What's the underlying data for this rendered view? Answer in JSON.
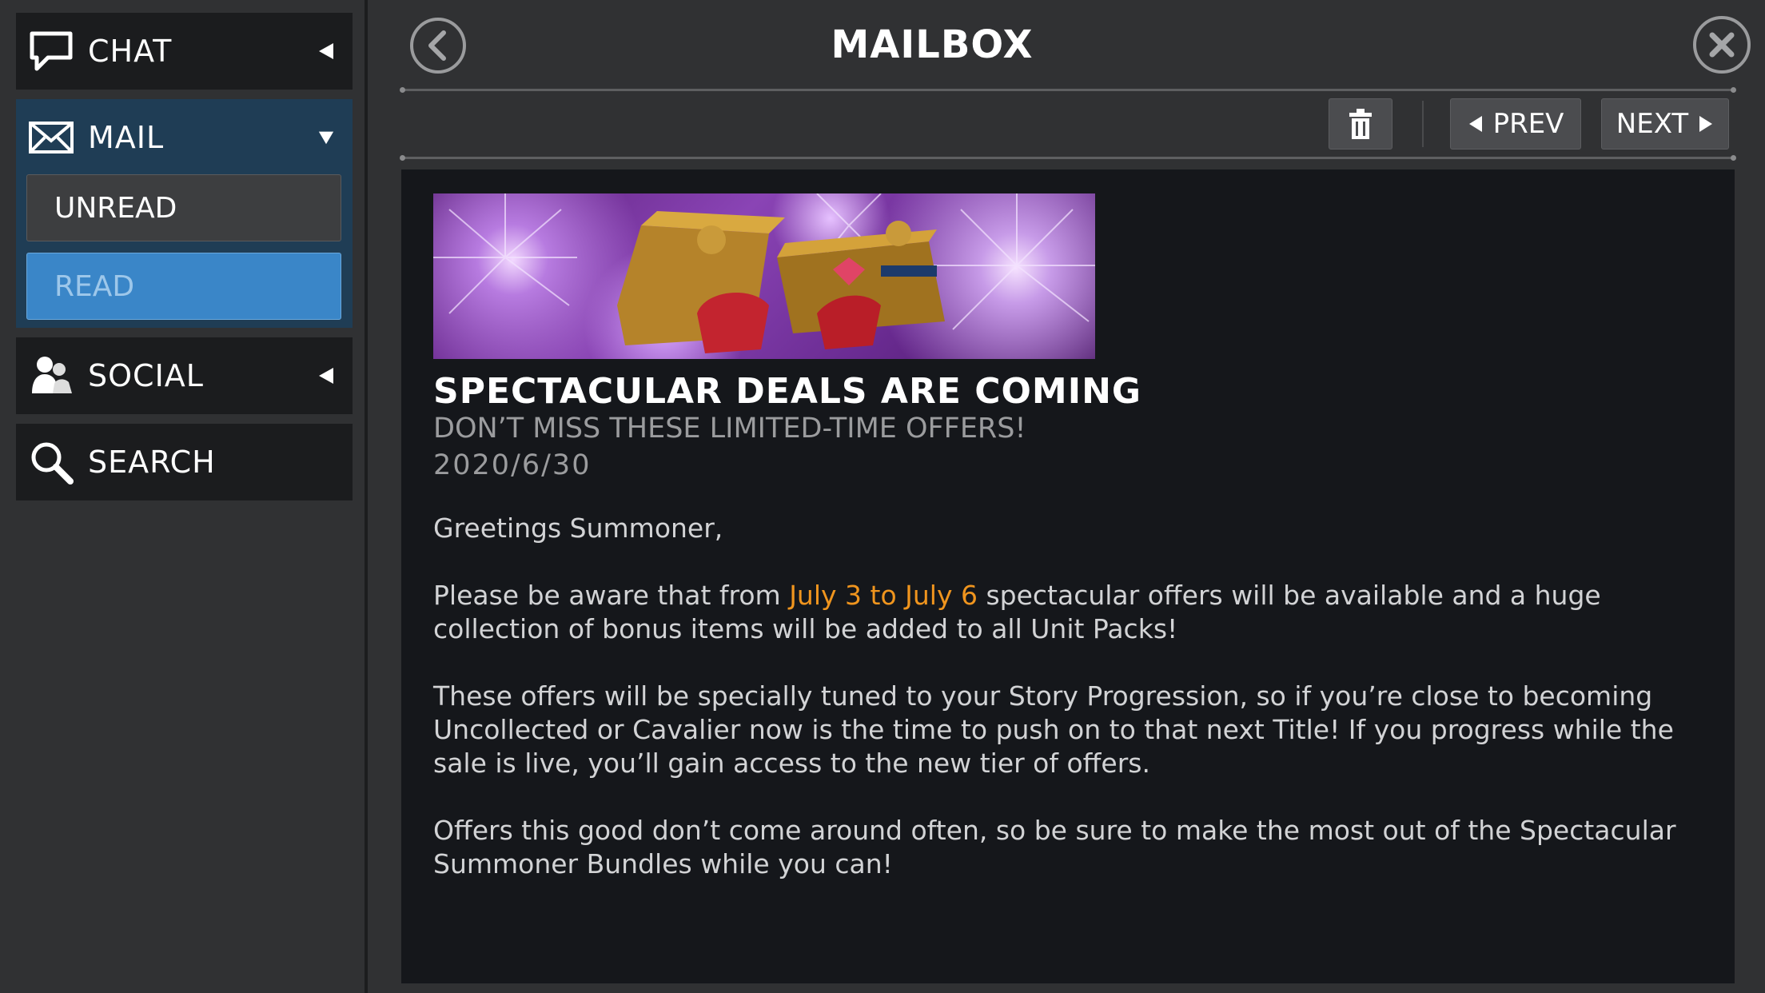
{
  "sidebar": {
    "chat": {
      "label": "CHAT",
      "icon": "speech-bubble-icon"
    },
    "mail": {
      "label": "MAIL",
      "icon": "envelope-icon"
    },
    "mail_sub": {
      "unread": "UNREAD",
      "read": "READ"
    },
    "social": {
      "label": "SOCIAL",
      "icon": "people-icon"
    },
    "search": {
      "label": "SEARCH",
      "icon": "magnifier-icon"
    }
  },
  "header": {
    "title": "MAILBOX",
    "back_icon": "chevron-left-icon",
    "close_icon": "close-icon"
  },
  "toolbar": {
    "delete_icon": "trash-icon",
    "prev_label": "PREV",
    "next_label": "NEXT"
  },
  "message": {
    "title": "SPECTACULAR DEALS ARE COMING",
    "subtitle": "DON’T MISS THESE LIMITED-TIME OFFERS!",
    "date": "2020/6/30",
    "greeting": "Greetings Summoner,",
    "p1_before": "Please be aware that from ",
    "p1_highlight": "July 3 to July 6",
    "p1_after": " spectacular offers will be available and a huge collection of bonus items will be added to all Unit Packs!",
    "p2": "These offers will be specially tuned to your Story Progression, so if you’re close to becoming Uncollected or Cavalier now is the time to push on to that next Title! If you progress while the sale is live, you’ll gain access to the new tier of offers.",
    "p3": "Offers this good don’t come around often, so be sure to make the most out of the Spectacular Summoner Bundles while you can!"
  },
  "colors": {
    "highlight": "#f0951e",
    "selected_tab": "#3a86c8",
    "panel_bg": "#15171b"
  }
}
